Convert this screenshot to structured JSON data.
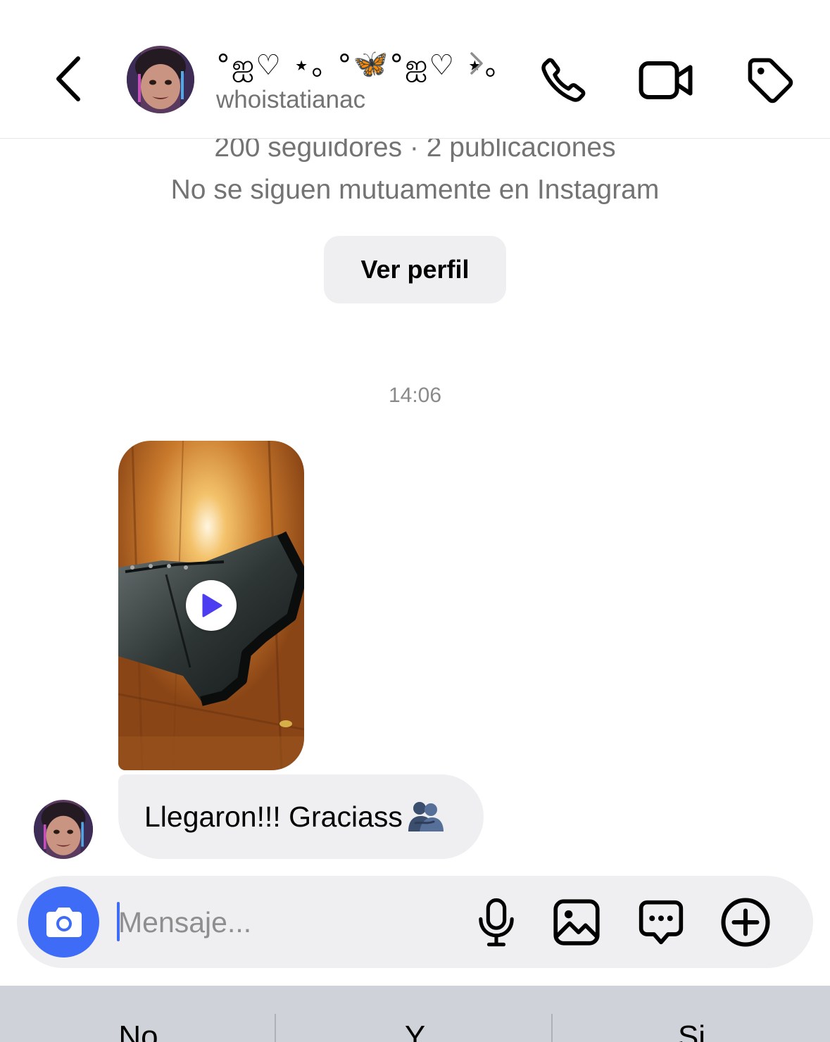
{
  "header": {
    "display_name_left": "°ஐ♡ ⋆｡ °",
    "display_name_butterfly": "🦋",
    "display_name_right": "°ஐ♡ ⋆｡",
    "username": "whoistatianac",
    "icons": {
      "back": "chevron-left-icon",
      "name_more": "chevron-right-icon",
      "call": "phone-icon",
      "video": "video-camera-icon",
      "tag": "tag-icon"
    }
  },
  "profile_summary": {
    "stats": "200 seguidores · 2 publicaciones",
    "mutual": "No se siguen mutuamente en Instagram",
    "view_profile_label": "Ver perfil"
  },
  "conversation": {
    "timestamp": "14:06",
    "messages": [
      {
        "type": "video",
        "description_icon": "play-icon"
      },
      {
        "type": "text",
        "text": "Llegaron!!! Graciass",
        "emoji_icon": "people-hugging-icon"
      }
    ]
  },
  "composer": {
    "placeholder": "Mensaje...",
    "icons": {
      "camera": "camera-icon",
      "mic": "microphone-icon",
      "gallery": "image-icon",
      "chat": "message-bubble-icon",
      "add": "plus-circle-icon"
    }
  },
  "keyboard": {
    "suggestions": [
      "No",
      "Y",
      "Si"
    ]
  },
  "colors": {
    "accent": "#3f6cf7",
    "bubble": "#efeff1",
    "secondary_text": "#737373",
    "keyboard_bg": "#cfd2d9"
  }
}
